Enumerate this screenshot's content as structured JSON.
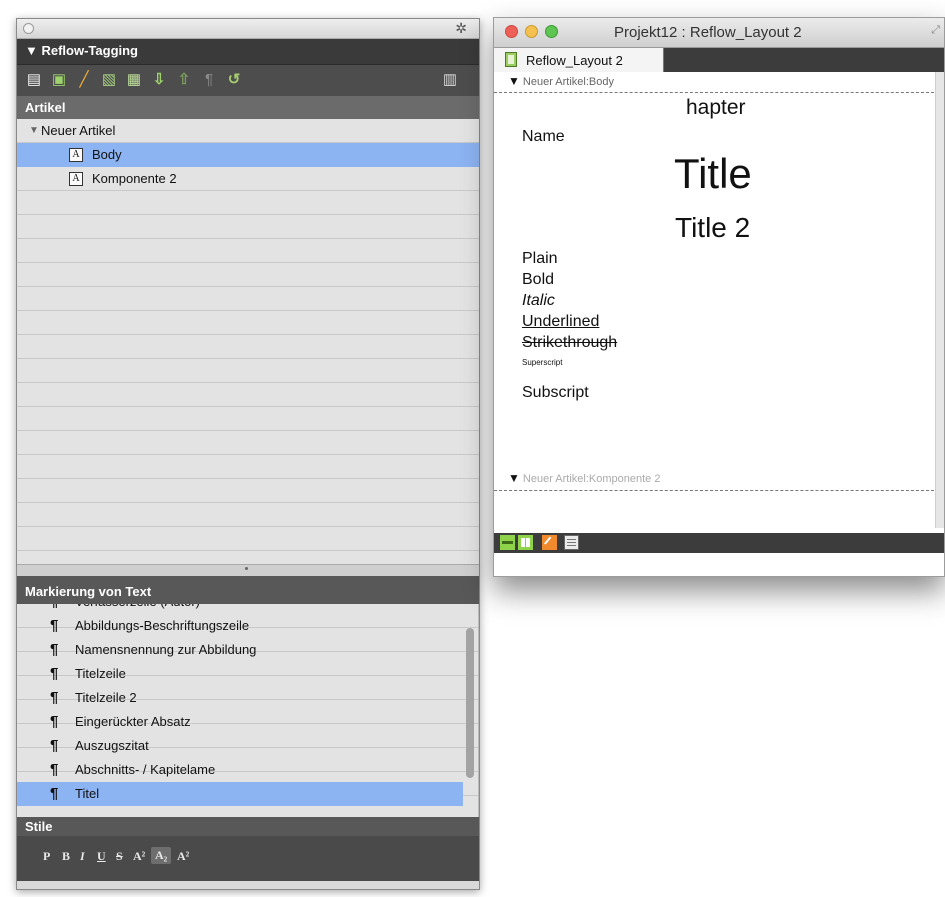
{
  "left_panel": {
    "title": "▼ Reflow-Tagging",
    "gear_icon": "✲",
    "toolbar_icons": [
      "new-article-icon",
      "add-component-icon",
      "pencil-icon",
      "tag-icon",
      "merge-icon",
      "move-down-icon",
      "move-up-icon",
      "paragraph-icon",
      "refresh-icon",
      "trash-icon"
    ],
    "artikel_header": "Artikel",
    "tree": {
      "root_label": "Neuer Artikel",
      "root_arrow": "▼",
      "children": [
        {
          "label": "Body",
          "icon": "A"
        },
        {
          "label": "Komponente 2",
          "icon": "A"
        }
      ]
    },
    "markup_header": "Markierung von Text",
    "markup_partial_item": "Verfasserzeile (Autor)",
    "pilcrow": "¶",
    "markup_items": [
      "Abbildungs-Beschriftungszeile",
      "Namensnennung zur Abbildung",
      "Titelzeile",
      "Titelzeile 2",
      "Eingerückter Absatz",
      "Auszugszitat",
      "Abschnitts- / Kapitelame",
      "Titel"
    ],
    "stile_header": "Stile",
    "style_buttons": [
      "P",
      "B",
      "I",
      "U",
      "S",
      "A²",
      "A₂",
      "A²"
    ]
  },
  "doc_window": {
    "title": "Projekt12 : Reflow_Layout 2",
    "tab_label": "Reflow_Layout 2",
    "story1_label": "Neuer Artikel:Body",
    "story2_label": "Neuer Artikel:Komponente 2",
    "triangle": "▼",
    "content": {
      "chapter": "hapter",
      "name": "Name",
      "title": "Title",
      "title2": "Title 2",
      "plain": "Plain",
      "bold": "Bold",
      "italic": "Italic",
      "underlined": "Underlined",
      "strike": "Strikethrough",
      "superscript": "Superscript",
      "subscript": "Subscript"
    }
  },
  "colors": {
    "selection": "#8cb3f2",
    "panel_dark": "#3a3a3a"
  }
}
